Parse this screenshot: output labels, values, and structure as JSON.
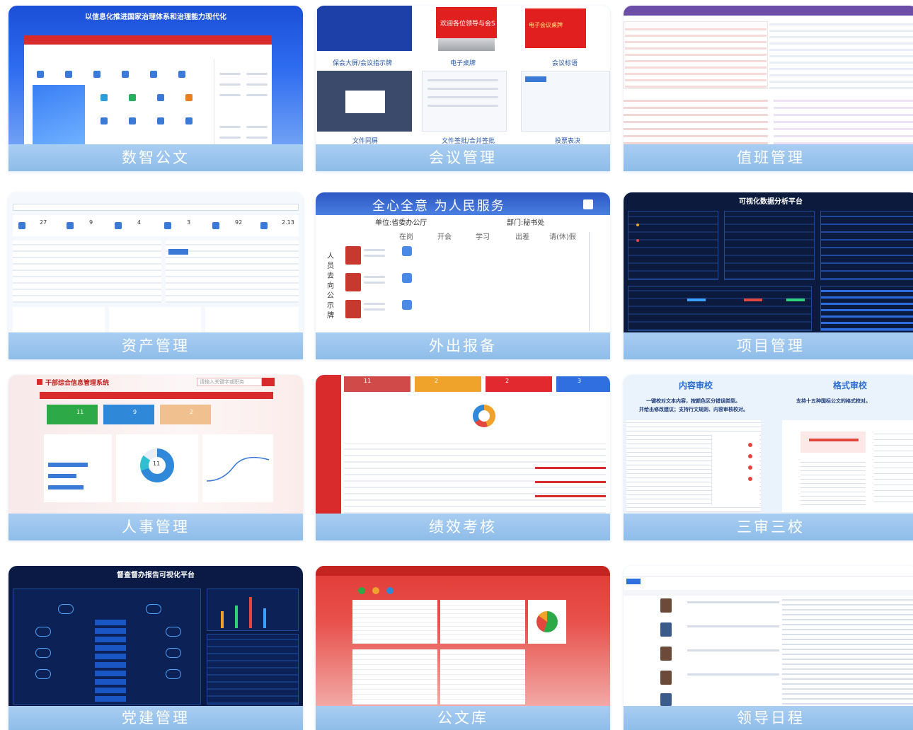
{
  "cards": [
    {
      "label": "数智公文",
      "banner": "以信息化推进国家治理体系和治理能力现代化"
    },
    {
      "label": "会议管理",
      "captions": [
        "保会大屏/会议指示牌",
        "电子桌牌",
        "会议标语",
        "文件同屏",
        "文件签批/合并签批",
        "投票表决"
      ],
      "screen1": "电子会议桌牌",
      "screen2": "欢迎各位领导与会S"
    },
    {
      "label": "值班管理"
    },
    {
      "label": "资产管理",
      "stats": [
        "27",
        "9",
        "4",
        "3",
        "92",
        "2.13"
      ]
    },
    {
      "label": "外出报备",
      "slogan": "全心全意  为人民服务",
      "unit": "单位:省委办公厅",
      "dept": "部门:秘书处",
      "cols": [
        "在岗",
        "开会",
        "学习",
        "出差",
        "请(休)假"
      ],
      "side": "人员去向公示牌"
    },
    {
      "label": "项目管理",
      "title": "可视化数据分析平台"
    },
    {
      "label": "人事管理",
      "title": "干部综合信息管理系统",
      "tiles": [
        "11",
        "9",
        "2"
      ],
      "donut": "11",
      "search": "请输入关键字或职务"
    },
    {
      "label": "绩效考核",
      "stats": [
        "11",
        "2",
        "2",
        "3"
      ]
    },
    {
      "label": "三审三校",
      "left_title": "内容审校",
      "right_title": "格式审校",
      "left_desc1": "一键校对文本内容，按颜色区分错误类型。",
      "left_desc2": "并给出修改建议；支持行文规则、内容审核校对。",
      "right_desc": "支持十五种国标公文的格式校对。"
    },
    {
      "label": "党建管理",
      "title": "督查督办报告可视化平台"
    },
    {
      "label": "公文库"
    },
    {
      "label": "领导日程"
    }
  ]
}
